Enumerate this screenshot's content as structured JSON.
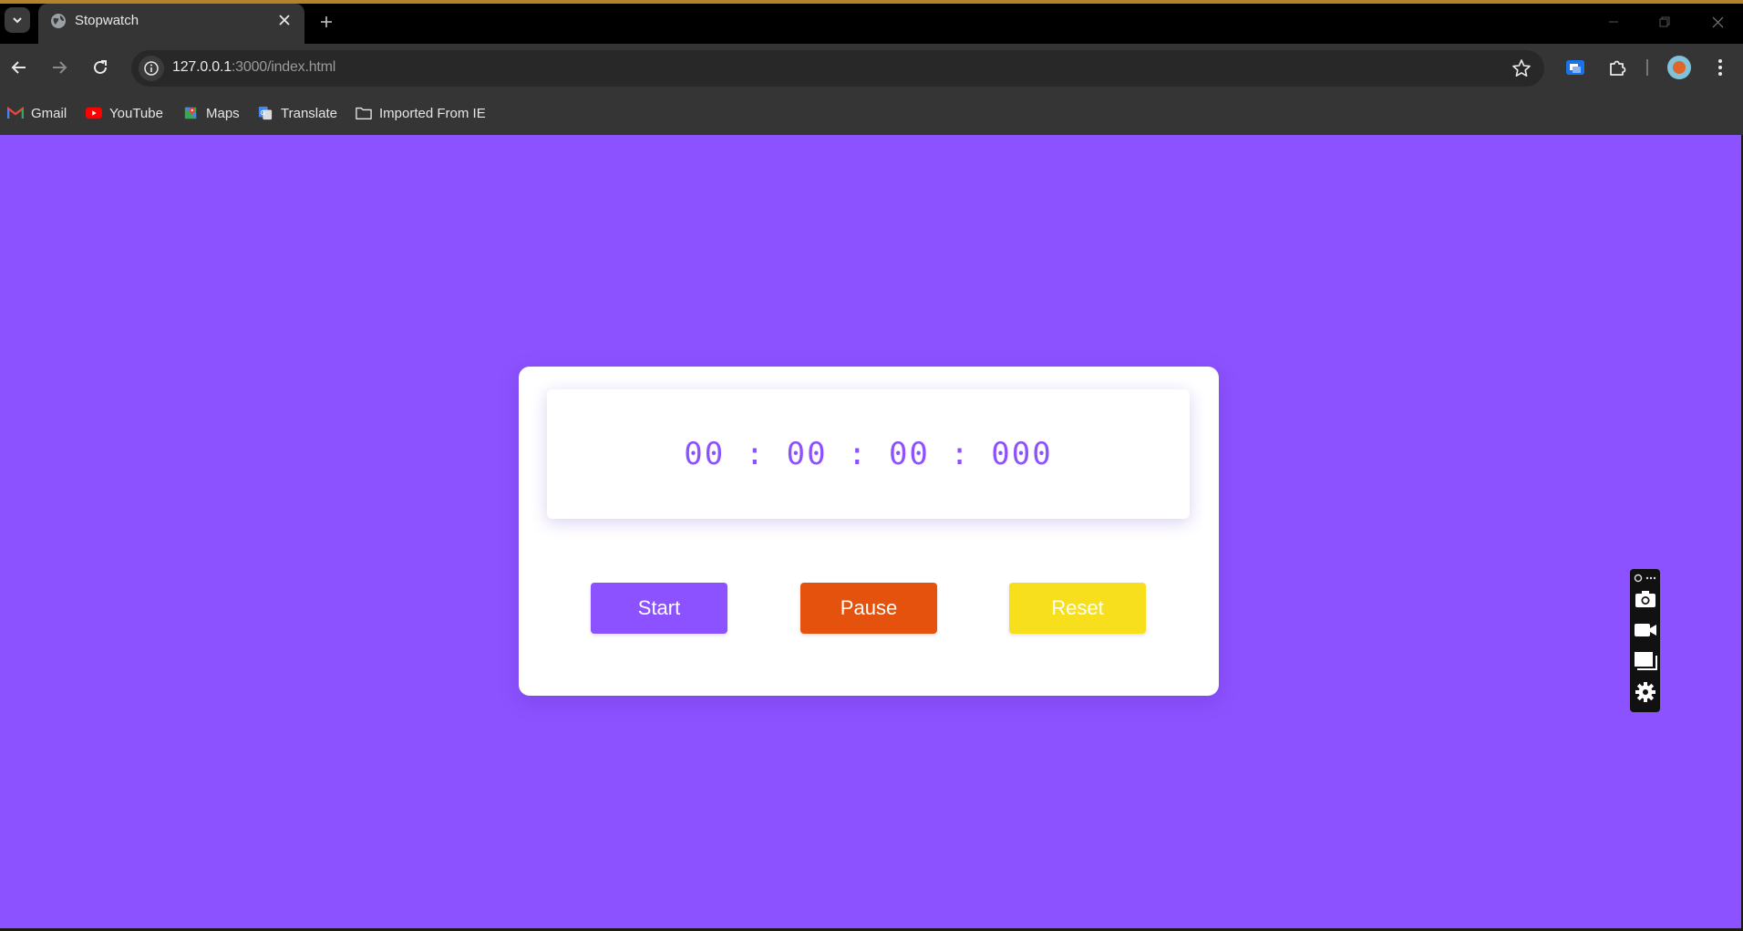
{
  "browser": {
    "tab": {
      "title": "Stopwatch",
      "favicon": "globe-icon"
    },
    "url": {
      "host": "127.0.0.1",
      "path": ":3000/index.html"
    },
    "bookmarks": [
      {
        "label": "Gmail",
        "icon": "gmail-icon"
      },
      {
        "label": "YouTube",
        "icon": "youtube-icon"
      },
      {
        "label": "Maps",
        "icon": "maps-icon"
      },
      {
        "label": "Translate",
        "icon": "translate-icon"
      },
      {
        "label": "Imported From IE",
        "icon": "folder-icon"
      }
    ]
  },
  "stopwatch": {
    "time": "00 : 00 : 00 : 000",
    "buttons": {
      "start": {
        "label": "Start",
        "color": "#8c52ff"
      },
      "pause": {
        "label": "Pause",
        "color": "#e4520d"
      },
      "reset": {
        "label": "Reset",
        "color": "#f7df1e"
      }
    }
  },
  "colors": {
    "page_background": "#8c52ff",
    "accent": "#8c52ff"
  },
  "capture_widget": {
    "buttons": [
      "camera-icon",
      "video-icon",
      "window-icon",
      "gear-icon"
    ]
  }
}
